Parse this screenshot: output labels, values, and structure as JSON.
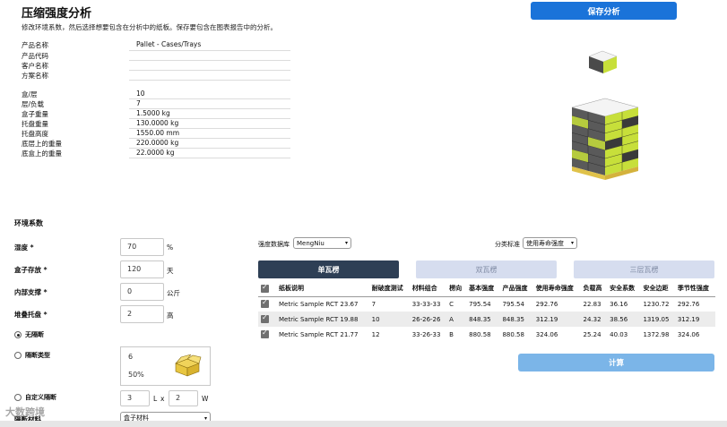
{
  "header": {
    "title": "压缩强度分析",
    "subtitle": "修改环境系数，然后选择想要包含在分析中的纸板。保存要包含在图表报告中的分析。",
    "save_label": "保存分析"
  },
  "info": [
    {
      "label": "产品名称",
      "value": "Pallet - Cases/Trays"
    },
    {
      "label": "产品代码",
      "value": ""
    },
    {
      "label": "客户名称",
      "value": ""
    },
    {
      "label": "方案名称",
      "value": ""
    }
  ],
  "specs": [
    {
      "label": "盒/层",
      "value": "10"
    },
    {
      "label": "层/负载",
      "value": "7"
    },
    {
      "label": "盒子重量",
      "value": "1.5000  kg"
    },
    {
      "label": "托盘重量",
      "value": "130.0000  kg"
    },
    {
      "label": "托盘高度",
      "value": "1550.00  mm"
    },
    {
      "label": "底层上的重量",
      "value": "220.0000  kg"
    },
    {
      "label": "底盒上的重量",
      "value": "22.0000  kg"
    }
  ],
  "env": {
    "title": "环境系数",
    "humidity": {
      "label": "湿度 *",
      "value": "70",
      "unit": "%"
    },
    "storage": {
      "label": "盒子存放 *",
      "value": "120",
      "unit": "天"
    },
    "internal": {
      "label": "内部支撑 *",
      "value": "0",
      "unit": "公斤"
    },
    "stack": {
      "label": "堆叠托盘 *",
      "value": "2",
      "unit": "高"
    },
    "no_sep": "无隔断",
    "sep_type": "隔断类型",
    "sep_val1": "6",
    "sep_val2": "50%",
    "custom_sep": "自定义隔断",
    "custom_l": "3",
    "custom_w": "2",
    "l_label": "L",
    "x_label": "x",
    "w_label": "W",
    "sep_material_label": "隔断材料",
    "sep_material_value": "盒子材料"
  },
  "db": {
    "label": "强度数据库",
    "value": "MengNiu",
    "class_label": "分类标准",
    "class_value": "使用寿命强度"
  },
  "tabs": [
    "单瓦楞",
    "双瓦楞",
    "三层瓦楞"
  ],
  "table": {
    "headers": [
      "纸板说明",
      "耐破度测试",
      "材料组合",
      "楞向",
      "基本强度",
      "产品强度",
      "使用寿命强度",
      "负载高",
      "安全系数",
      "安全边距",
      "季节性强度"
    ],
    "rows": [
      [
        "Metric Sample RCT 23.67",
        "7",
        "33-33-33",
        "C",
        "795.54",
        "795.54",
        "292.76",
        "22.83",
        "36.16",
        "1230.72",
        "292.76"
      ],
      [
        "Metric Sample RCT 19.88",
        "10",
        "26-26-26",
        "A",
        "848.35",
        "848.35",
        "312.19",
        "24.32",
        "38.56",
        "1319.05",
        "312.19"
      ],
      [
        "Metric Sample RCT 21.77",
        "12",
        "33-26-33",
        "B",
        "880.58",
        "880.58",
        "324.06",
        "25.24",
        "40.03",
        "1372.98",
        "324.06"
      ]
    ]
  },
  "calc_label": "计算",
  "watermark": "大数跨境",
  "colors": {
    "primary": "#1a73d9",
    "tab_active": "#2e3f55",
    "tab_inactive": "#d6ddef",
    "calc": "#7bb5e8",
    "box_green": "#c7df3a",
    "box_dark": "#3a3a3a",
    "pallet": "#e0c24a"
  }
}
